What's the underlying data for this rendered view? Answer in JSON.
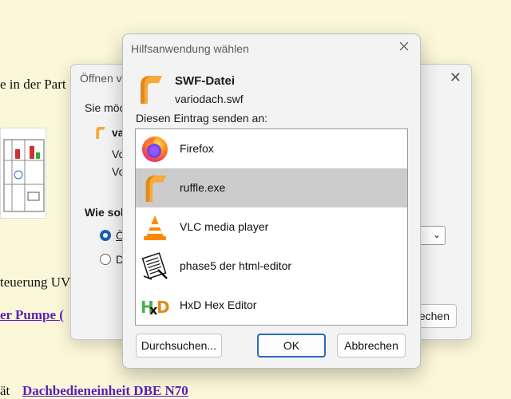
{
  "background_page": {
    "line1": "e in der Part",
    "line2": "teuerung UV",
    "link1": "er Pumpe (",
    "link2_prefix": "ät",
    "link2": "Dachbedieneinheit DBE N70"
  },
  "back_dialog": {
    "title": "Öffnen v",
    "question": "Sie möc",
    "file_label": "va",
    "line_a": "Vo",
    "line_b": "Vo",
    "how_label": "Wie soll",
    "option_1": "Ö",
    "option_2": "D",
    "button_partial": "echen"
  },
  "dialog": {
    "title": "Hilfsanwendung wählen",
    "file_type": "SWF-Datei",
    "file_name": "variodach.swf",
    "send_label": "Diesen Eintrag senden an:",
    "apps": [
      {
        "label": "Firefox",
        "icon": "firefox-icon",
        "selected": false
      },
      {
        "label": "ruffle.exe",
        "icon": "ruffle-icon",
        "selected": true
      },
      {
        "label": "VLC media player",
        "icon": "vlc-icon",
        "selected": false
      },
      {
        "label": "phase5 der html-editor",
        "icon": "phase5-icon",
        "selected": false
      },
      {
        "label": "HxD Hex Editor",
        "icon": "hxd-icon",
        "selected": false
      }
    ],
    "buttons": {
      "browse": "Durchsuchen...",
      "ok": "OK",
      "cancel": "Abbrechen"
    }
  },
  "colors": {
    "page_background": "#fbf7d9",
    "link": "#5a1fb8",
    "selection": "#cccccc",
    "default_button_border": "#2e67c0",
    "ruffle_orange": "#f7a93b"
  }
}
